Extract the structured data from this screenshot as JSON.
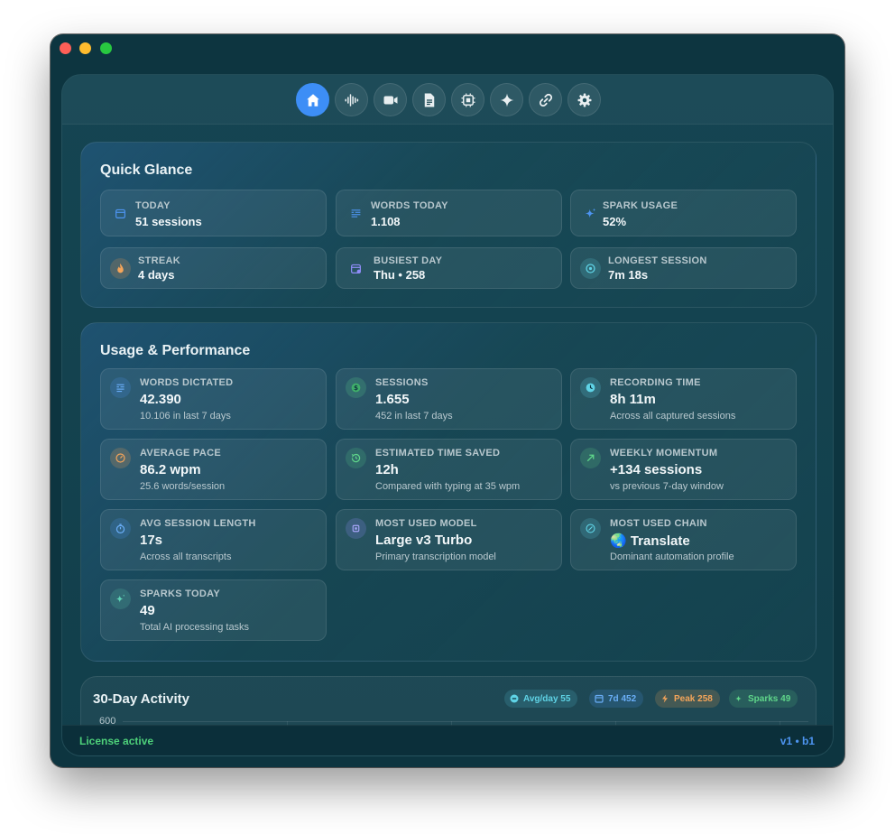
{
  "toolbar": {
    "icons": [
      "home-icon",
      "waveform-icon",
      "video-icon",
      "document-icon",
      "chip-icon",
      "sparkle-icon",
      "link-icon",
      "gear-icon"
    ],
    "active": "home-icon",
    "accent": "#3d8ef6"
  },
  "quick_glance": {
    "title": "Quick Glance",
    "cards": [
      {
        "label": "TODAY",
        "value": "51 sessions",
        "icon": "calendar-icon"
      },
      {
        "label": "WORDS TODAY",
        "value": "1.108",
        "icon": "text-lines-icon"
      },
      {
        "label": "SPARK USAGE",
        "value": "52%",
        "icon": "sparkle-icon"
      },
      {
        "label": "STREAK",
        "value": "4 days",
        "icon": "flame-icon"
      },
      {
        "label": "BUSIEST DAY",
        "value": "Thu • 258",
        "icon": "calendar-badge-icon"
      },
      {
        "label": "LONGEST SESSION",
        "value": "7m 18s",
        "icon": "stopwatch-icon"
      }
    ]
  },
  "usage": {
    "title": "Usage & Performance",
    "cards": [
      {
        "label": "WORDS DICTATED",
        "value": "42.390",
        "sub": "10.106 in last 7 days",
        "icon": "text-lines-icon"
      },
      {
        "label": "SESSIONS",
        "value": "1.655",
        "sub": "452 in last 7 days",
        "icon": "dollar-icon"
      },
      {
        "label": "RECORDING TIME",
        "value": "8h 11m",
        "sub": "Across all captured sessions",
        "icon": "clock-icon"
      },
      {
        "label": "AVERAGE PACE",
        "value": "86.2 wpm",
        "sub": "25.6 words/session",
        "icon": "gauge-icon"
      },
      {
        "label": "ESTIMATED TIME SAVED",
        "value": "12h",
        "sub": "Compared with typing at 35 wpm",
        "icon": "history-icon"
      },
      {
        "label": "WEEKLY MOMENTUM",
        "value": "+134 sessions",
        "sub": "vs previous 7-day window",
        "icon": "arrow-up-right-icon"
      },
      {
        "label": "AVG SESSION LENGTH",
        "value": "17s",
        "sub": "Across all transcripts",
        "icon": "timer-icon"
      },
      {
        "label": "MOST USED MODEL",
        "value": "Large v3 Turbo",
        "sub": "Primary transcription model",
        "icon": "chip-icon"
      },
      {
        "label": "MOST USED CHAIN",
        "value": "🌏 Translate",
        "sub": "Dominant automation profile",
        "icon": "compass-icon"
      },
      {
        "label": "SPARKS TODAY",
        "value": "49",
        "sub": "Total AI processing tasks",
        "icon": "sparkle-icon"
      }
    ]
  },
  "activity": {
    "title": "30-Day Activity",
    "pills": [
      {
        "text": "Avg/day 55",
        "icon": "minus-circle-icon",
        "color": "#5fd3e6"
      },
      {
        "text": "7d 452",
        "icon": "calendar-icon",
        "color": "#6aaef7"
      },
      {
        "text": "Peak 258",
        "icon": "bolt-icon",
        "color": "#f5a55a"
      },
      {
        "text": "Sparks 49",
        "icon": "sparkle-icon",
        "color": "#5fd68a"
      }
    ],
    "y_top_label": "600"
  },
  "footer": {
    "license": "License active",
    "version": "v1 • b1"
  }
}
